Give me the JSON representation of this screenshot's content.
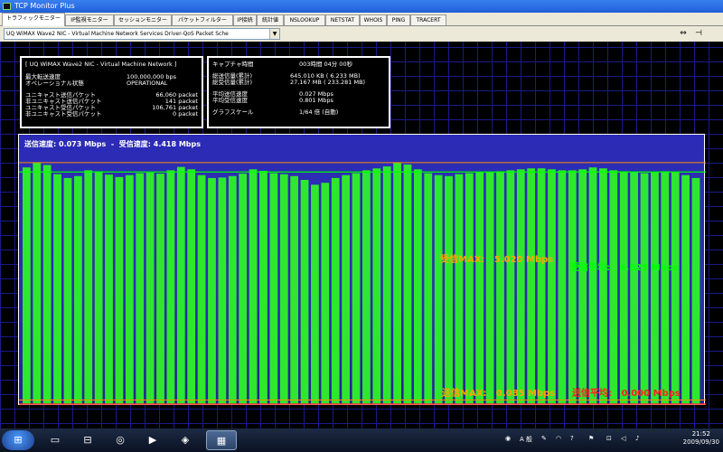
{
  "window": {
    "title": "TCP Monitor Plus"
  },
  "tabs": [
    "トラフィックモニター",
    "IP監視モニター",
    "セッションモニター",
    "パケットフィルター",
    "IP接続",
    "統計値",
    "NSLOOKUP",
    "NETSTAT",
    "WHOIS",
    "PING",
    "TRACERT"
  ],
  "toolbar": {
    "adapter": "UQ WiMAX Wave2 NIC - Virtual Machine Network Services Driver-QoS Packet Sche"
  },
  "adapter_panel": {
    "header": "[ UQ WiMAX Wave2 NIC - Virtual Machine Network ]",
    "rows": [
      {
        "label": "最大転送速度",
        "value": "100,000,000 bps"
      },
      {
        "label": "オペレーショナル状態",
        "value": "OPERATIONAL"
      }
    ],
    "packets": [
      {
        "label": "ユニキャスト送信パケット",
        "value": "66,060 packet"
      },
      {
        "label": "非ユニキャスト送信パケット",
        "value": "141 packet"
      },
      {
        "label": "ユニキャスト受信パケット",
        "value": "106,761 packet"
      },
      {
        "label": "非ユニキャスト受信パケット",
        "value": "0 packet"
      }
    ]
  },
  "capture_panel": {
    "time_label": "キャプチャ時間",
    "time_value": "003時間 04分 00秒",
    "totals": [
      {
        "label": "総送信量(累計)",
        "value": "645.010 KB (   6.233 MB)"
      },
      {
        "label": "総受信量(累計)",
        "value": "27,167 MB ( 233.281 MB)"
      }
    ],
    "speeds": [
      {
        "label": "平均送信速度",
        "value": "0.027 Mbps"
      },
      {
        "label": "平均受信速度",
        "value": "0.801 Mbps"
      }
    ],
    "scale_label": "グラフスケール",
    "scale_value": "1/64 倍 (自動)"
  },
  "graph": {
    "status_tx_label": "送信速度:",
    "status_tx": "0.073 Mbps",
    "status_sep": "-",
    "status_rx_label": "受信速度:",
    "status_rx": "4.418 Mbps",
    "rx_max_label": "受信MAX:",
    "rx_max": "5.020 Mbps",
    "rx_avg_label": "受信平均:",
    "rx_avg": "4.825 Mbps",
    "tx_max_label": "送信MAX:",
    "tx_max": "0.085 Mbps",
    "tx_avg_label": "送信平均:",
    "tx_avg": "0.000 Mbps",
    "colors": {
      "rx_bars": "#2ee82e",
      "rx_avg_line": "#00ff00",
      "max_line": "#ff8c00",
      "tx_line": "#ff2a2a",
      "label_orange": "#ffa500",
      "label_red": "#ff2020"
    }
  },
  "chart_data": {
    "type": "bar",
    "title": "",
    "series": [
      {
        "name": "受信",
        "values": [
          4.92,
          5.02,
          4.97,
          4.78,
          4.7,
          4.74,
          4.86,
          4.84,
          4.77,
          4.72,
          4.76,
          4.8,
          4.81,
          4.79,
          4.86,
          4.93,
          4.88,
          4.76,
          4.7,
          4.71,
          4.74,
          4.79,
          4.88,
          4.85,
          4.8,
          4.78,
          4.74,
          4.66,
          4.56,
          4.6,
          4.7,
          4.76,
          4.8,
          4.86,
          4.9,
          4.94,
          5.02,
          4.98,
          4.88,
          4.8,
          4.76,
          4.74,
          4.78,
          4.8,
          4.82,
          4.83,
          4.84,
          4.86,
          4.88,
          4.9,
          4.9,
          4.88,
          4.86,
          4.86,
          4.88,
          4.92,
          4.9,
          4.86,
          4.84,
          4.82,
          4.8,
          4.82,
          4.84,
          4.82,
          4.76,
          4.7
        ]
      }
    ],
    "ylim": [
      0,
      5.6
    ],
    "reference_lines": {
      "rx_max": 5.02,
      "rx_avg": 4.825,
      "tx_max": 0.085,
      "tx_avg": 0.0
    }
  },
  "taskbar": {
    "tray_lang": "A 般",
    "clock_time": "21:52",
    "clock_date": "2009/09/30"
  }
}
